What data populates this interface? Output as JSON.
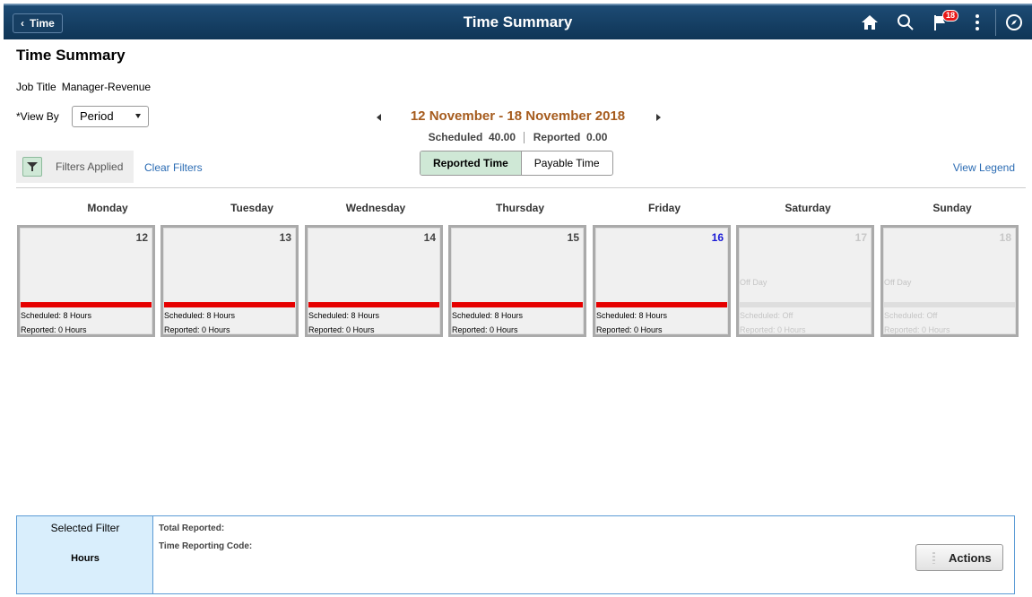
{
  "banner": {
    "back_label": "Time",
    "title": "Time Summary",
    "notification_count": "18",
    "icons": [
      "home-icon",
      "search-icon",
      "flag-icon",
      "more-icon",
      "navbar-icon"
    ]
  },
  "page": {
    "title": "Time Summary",
    "job_title_label": "Job Title",
    "job_title_value": "Manager-Revenue",
    "view_by_label": "*View By",
    "view_by_value": "Period"
  },
  "period": {
    "range": "12 November - 18 November 2018",
    "scheduled_label": "Scheduled",
    "scheduled_value": "40.00",
    "reported_label": "Reported",
    "reported_value": "0.00"
  },
  "filters": {
    "applied_label": "Filters Applied",
    "clear_label": "Clear Filters",
    "view_legend_label": "View Legend"
  },
  "toggle": {
    "reported_label": "Reported Time",
    "payable_label": "Payable Time",
    "active": "Reported Time"
  },
  "days": [
    {
      "name": "Monday",
      "num": "12",
      "off_label": "",
      "sched": "Scheduled: 8 Hours",
      "rep": "Reported: 0 Hours"
    },
    {
      "name": "Tuesday",
      "num": "13",
      "off_label": "",
      "sched": "Scheduled: 8 Hours",
      "rep": "Reported: 0 Hours"
    },
    {
      "name": "Wednesday",
      "num": "14",
      "off_label": "",
      "sched": "Scheduled: 8 Hours",
      "rep": "Reported: 0 Hours"
    },
    {
      "name": "Thursday",
      "num": "15",
      "off_label": "",
      "sched": "Scheduled: 8 Hours",
      "rep": "Reported: 0 Hours"
    },
    {
      "name": "Friday",
      "num": "16",
      "off_label": "",
      "sched": "Scheduled: 8 Hours",
      "rep": "Reported: 0 Hours"
    },
    {
      "name": "Saturday",
      "num": "17",
      "off_label": "Off Day",
      "sched": "Scheduled: Off",
      "rep": "Reported: 0 Hours"
    },
    {
      "name": "Sunday",
      "num": "18",
      "off_label": "Off Day",
      "sched": "Scheduled: Off",
      "rep": "Reported: 0 Hours"
    }
  ],
  "bottom": {
    "selected_filter_label": "Selected Filter",
    "selected_filter_value": "Hours",
    "total_reported_label": "Total Reported:",
    "trc_label": "Time Reporting Code:",
    "actions_label": "Actions"
  },
  "colors": {
    "banner": "#0f3556",
    "period_text": "#a65c1e",
    "scheduled_bar": "#e60000",
    "active_toggle": "#cfe8d6",
    "link": "#2a6bb3",
    "today": "#1b1bd6"
  }
}
